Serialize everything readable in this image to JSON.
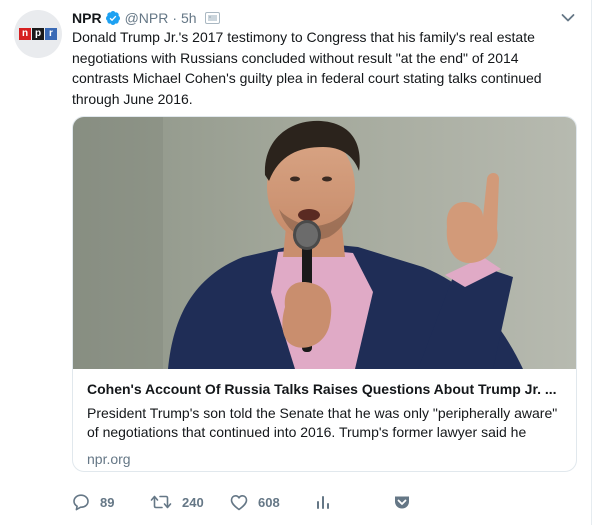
{
  "tweet": {
    "author_name": "NPR",
    "handle": "@NPR",
    "separator": "·",
    "time": "5h",
    "text": "Donald Trump Jr.'s 2017 testimony to Congress that his family's real estate\nnegotiations with Russians concluded without result \"at the end\" of 2014\ncontrasts Michael Cohen's guilty plea in federal court stating talks continued\nthrough June 2016.",
    "avatar_logo": [
      "n",
      "p",
      "r"
    ]
  },
  "card": {
    "title": "Cohen's Account Of Russia Talks Raises Questions About Trump Jr. ...",
    "description": "President Trump's son told the Senate that he was only \"peripherally aware\" of negotiations that continued into 2016. Trump's former lawyer said he",
    "domain": "npr.org"
  },
  "actions": {
    "replies": "89",
    "retweets": "240",
    "likes": "608"
  },
  "icons": {
    "verified": "verified-badge-icon",
    "media": "media-attachment-icon",
    "caret": "chevron-down-icon",
    "reply": "reply-icon",
    "retweet": "retweet-icon",
    "like": "heart-icon",
    "analytics": "analytics-icon",
    "pocket": "pocket-save-icon"
  },
  "colors": {
    "verified_blue": "#1da1f2",
    "secondary_text": "#657786",
    "pocket_red": "#ef4056",
    "npr_red": "#d62021",
    "npr_black": "#1a1a1a",
    "npr_blue": "#3a6ab5"
  }
}
